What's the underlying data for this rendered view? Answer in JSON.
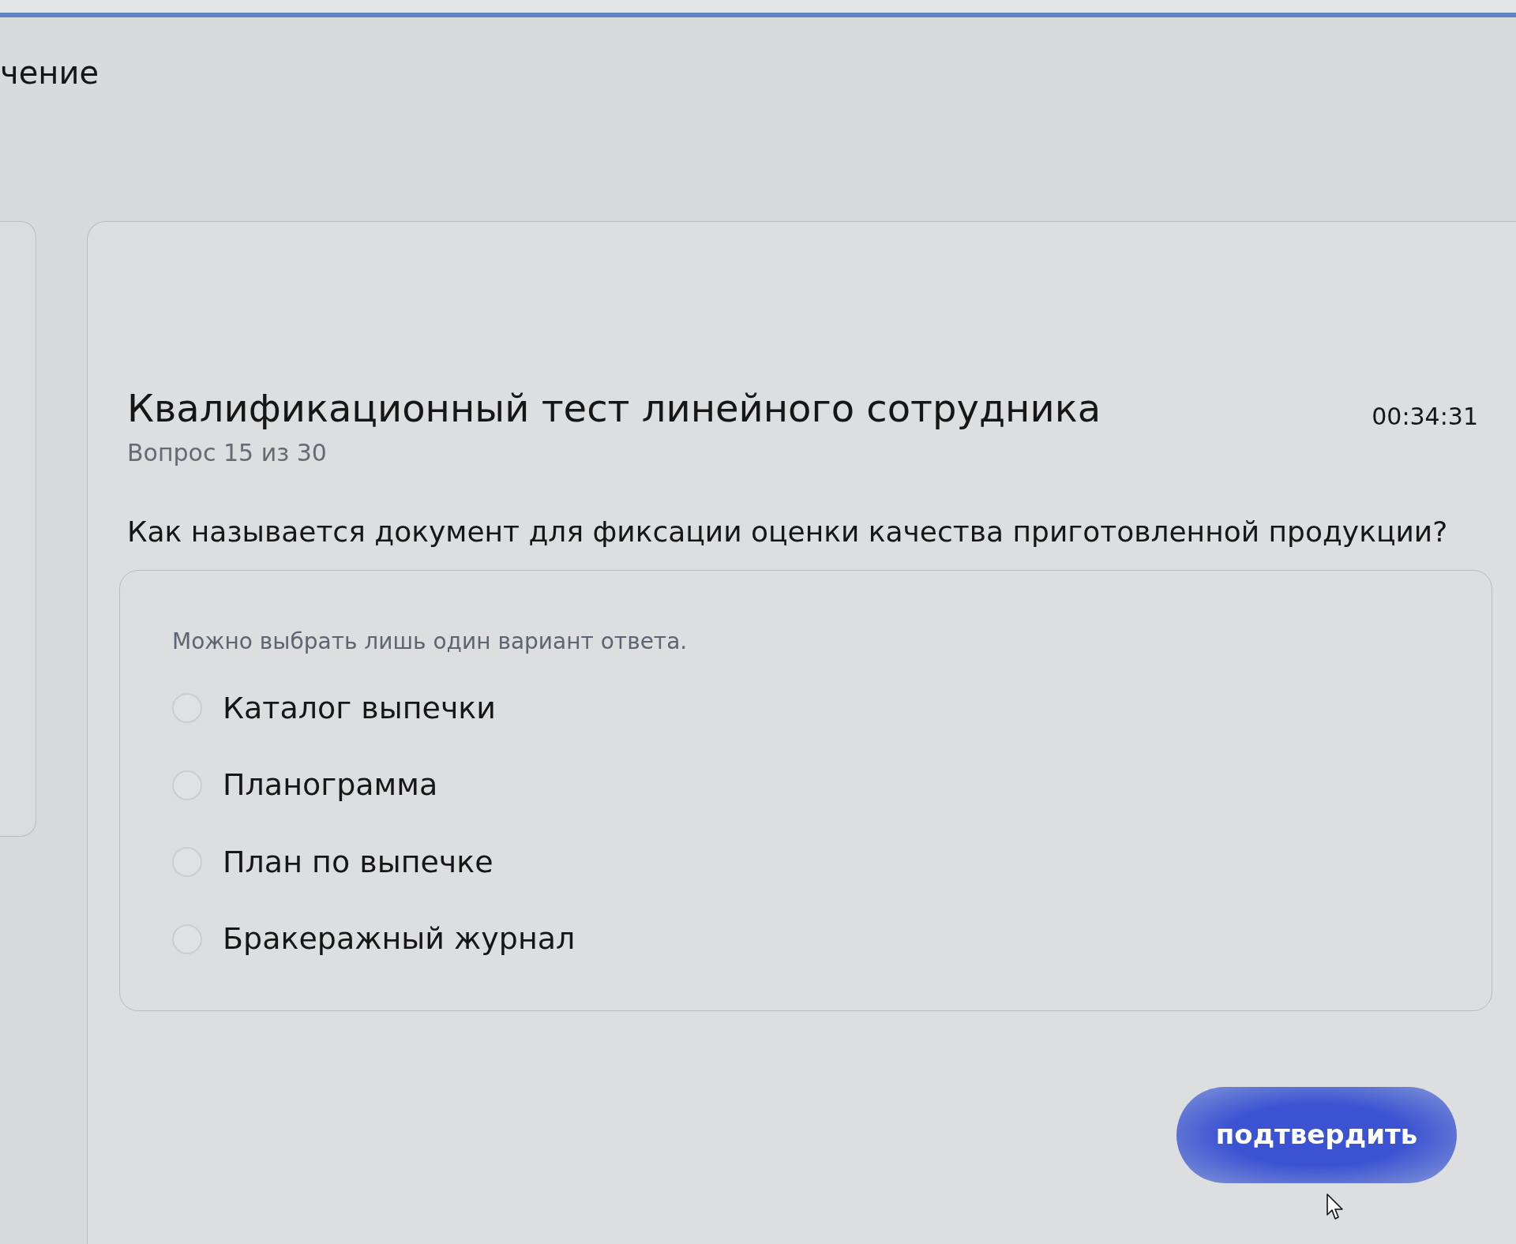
{
  "header": {
    "title": "чение"
  },
  "test": {
    "title": "Квалификационный тест линейного сотрудника",
    "timer": "00:34:31",
    "progress": "Вопрос 15 из 30",
    "question": "Как называется документ для фиксации оценки качества приготовленной продукции?",
    "hint": "Можно выбрать лишь один вариант ответа.",
    "options": [
      {
        "label": "Каталог выпечки",
        "selected": false
      },
      {
        "label": "Планограмма",
        "selected": false
      },
      {
        "label": "План по выпечке",
        "selected": false
      },
      {
        "label": "Бракеражный журнал",
        "selected": false
      }
    ],
    "submit_button": "подтвердить"
  }
}
